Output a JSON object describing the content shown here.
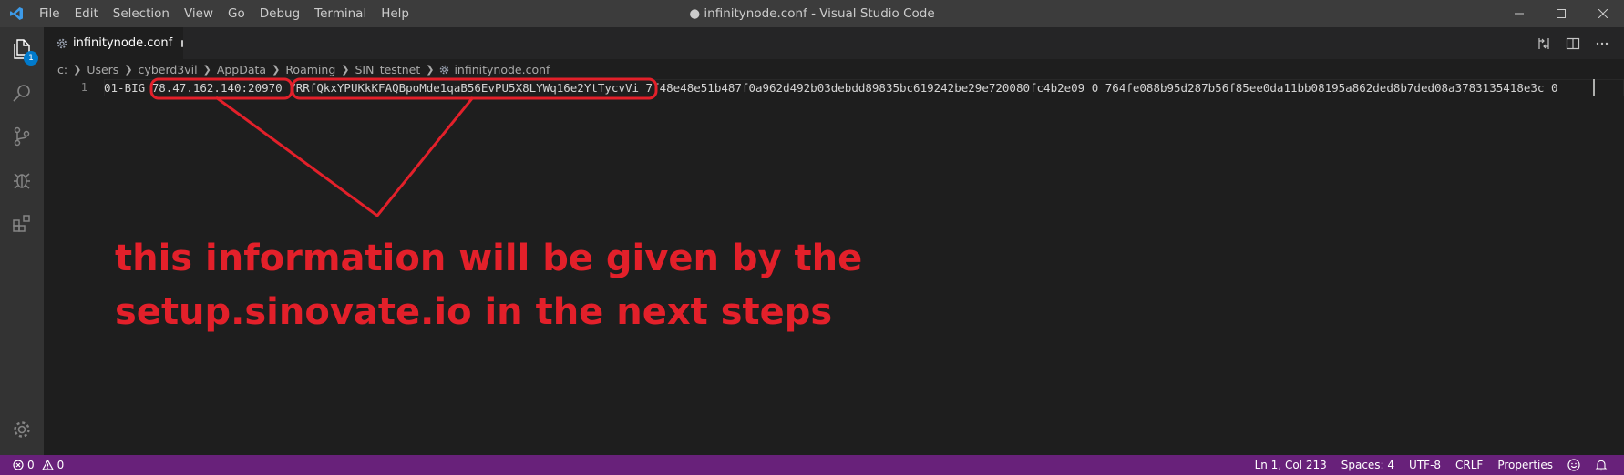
{
  "window": {
    "title": "● infinitynode.conf - Visual Studio Code"
  },
  "menu": {
    "items": [
      "File",
      "Edit",
      "Selection",
      "View",
      "Go",
      "Debug",
      "Terminal",
      "Help"
    ]
  },
  "activity_bar": {
    "explorer_badge": "1"
  },
  "tab": {
    "label": "infinitynode.conf"
  },
  "breadcrumb": {
    "items": [
      "c:",
      "Users",
      "cyberd3vil",
      "AppData",
      "Roaming",
      "SIN_testnet",
      "infinitynode.conf"
    ]
  },
  "editor": {
    "line_number": "1",
    "segments": {
      "prefix": "01-BIG ",
      "ip_port": "78.47.162.140:20970",
      "space1": " ",
      "address": "7RRfQkxYPUKkKFAQBpoMde1qaB56EvPU5X8LYWq16e2YtTycvVi",
      "rest": " 7f48e48e51b487f0a962d492b03debdd89835bc619242be29e720080fc4b2e09 0 764fe088b95d287b56f85ee0da11bb08195a862ded8b7ded08a3783135418e3c 0"
    }
  },
  "annotation": {
    "text": "this information will be given by the\nsetup.sinovate.io in the next steps",
    "color": "#e3202a"
  },
  "status_bar": {
    "errors": "0",
    "warnings": "0",
    "position": "Ln 1, Col 213",
    "spaces": "Spaces: 4",
    "encoding": "UTF-8",
    "eol": "CRLF",
    "language": "Properties",
    "background": "#68217a"
  }
}
